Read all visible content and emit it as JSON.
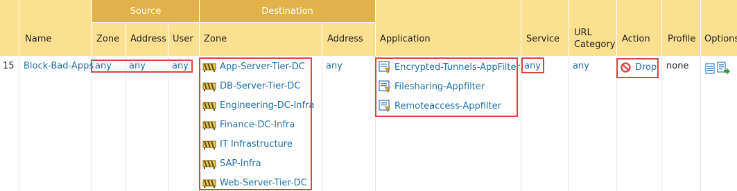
{
  "header": {
    "groups": {
      "source": "Source",
      "destination": "Destination"
    },
    "columns": {
      "row_number": "",
      "name": "Name",
      "source_zone": "Zone",
      "source_address": "Address",
      "source_user": "User",
      "dest_zone": "Zone",
      "dest_address": "Address",
      "application": "Application",
      "service": "Service",
      "url_category": "URL Category",
      "action": "Action",
      "profile": "Profile",
      "options": "Options"
    }
  },
  "rule": {
    "number": "15",
    "name": "Block-Bad-Apps",
    "source_zone": "any",
    "source_address": "any",
    "source_user": "any",
    "dest_zones": [
      "App-Server-Tier-DC",
      "DB-Server-Tier-DC",
      "Engineering-DC-Infra",
      "Finance-DC-Infra",
      "IT Infrastructure",
      "SAP-Infra",
      "Web-Server-Tier-DC"
    ],
    "dest_address": "any",
    "applications": [
      "Encrypted-Tunnels-AppFilter",
      "Filesharing-Appfilter",
      "Remoteaccess-Appfilter"
    ],
    "service": "any",
    "url_category": "any",
    "action": "Drop",
    "profile": "none"
  },
  "icons": {
    "zone": "zone-icon",
    "application_filter": "app-filter-icon",
    "action": "drop-icon",
    "options": [
      "rule-details-icon",
      "rule-export-icon"
    ]
  },
  "colors": {
    "group_header": "#e2b24a",
    "column_header": "#fbe08f",
    "link": "#1f6fa8",
    "highlight": "#d9453f"
  }
}
